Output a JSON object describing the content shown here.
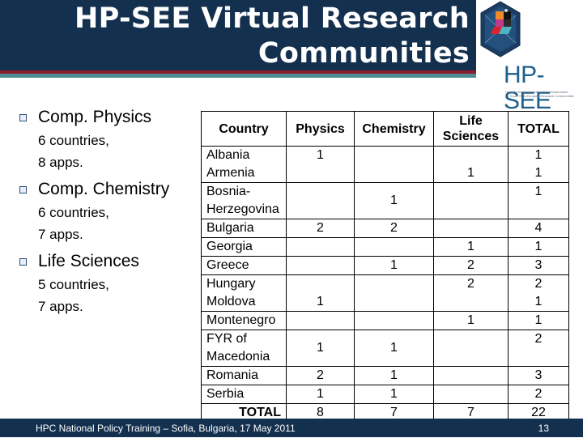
{
  "title": {
    "line1": "HP-SEE Virtual Research",
    "line2": "Communities"
  },
  "logo": {
    "name": "HP-SEE",
    "tagline_line1": "High-Performance Computing Infrastructure",
    "tagline_line2": "for South East Europe's Research Communities",
    "icon": "hp-see-hexagon-logo-icon"
  },
  "bullets": [
    {
      "heading": "Comp. Physics",
      "line1": "6 countries,",
      "line2": "8 apps.",
      "icon": "square-bullet-icon"
    },
    {
      "heading": "Comp. Chemistry",
      "line1": "6 countries,",
      "line2": "7 apps.",
      "icon": "square-bullet-icon"
    },
    {
      "heading": "Life Sciences",
      "line1": "5 countries,",
      "line2": "7 apps.",
      "icon": "square-bullet-icon"
    }
  ],
  "table": {
    "headers": {
      "country": "Country",
      "physics": "Physics",
      "chemistry": "Chemistry",
      "life_line1": "Life",
      "life_line2": "Sciences",
      "total": "TOTAL"
    },
    "rows": [
      {
        "country_lines": [
          "Albania",
          "Armenia"
        ],
        "physics": [
          "1",
          ""
        ],
        "chemistry": [
          "",
          ""
        ],
        "life": [
          "",
          "1"
        ],
        "total": [
          "1",
          "1"
        ]
      },
      {
        "country_lines": [
          "Bosnia-",
          "Herzegovina"
        ],
        "physics": "",
        "chemistry": "1",
        "life": "",
        "total": "1"
      },
      {
        "country": "Bulgaria",
        "physics": "2",
        "chemistry": "2",
        "life": "",
        "total": "4"
      },
      {
        "country": "Georgia",
        "physics": "",
        "chemistry": "",
        "life": "1",
        "total": "1"
      },
      {
        "country": "Greece",
        "physics": "",
        "chemistry": "1",
        "life": "2",
        "total": "3"
      },
      {
        "country_lines": [
          "Hungary",
          "Moldova"
        ],
        "physics": [
          "",
          "1"
        ],
        "chemistry": [
          "",
          ""
        ],
        "life": [
          "2",
          ""
        ],
        "total": [
          "2",
          "1"
        ]
      },
      {
        "country": "Montenegro",
        "physics": "",
        "chemistry": "",
        "life": "1",
        "total": "1"
      },
      {
        "country_lines": [
          "FYR of",
          "Macedonia"
        ],
        "physics": "1",
        "chemistry": "1",
        "life": "",
        "total": "2"
      },
      {
        "country": "Romania",
        "physics": "2",
        "chemistry": "1",
        "life": "",
        "total": "3"
      },
      {
        "country": "Serbia",
        "physics": "1",
        "chemistry": "1",
        "life": "",
        "total": "2"
      }
    ],
    "totals": {
      "label": "TOTAL",
      "physics": "8",
      "chemistry": "7",
      "life": "7",
      "total": "22"
    }
  },
  "footer": {
    "text": "HPC National Policy Training – Sofia, Bulgaria, 17 May 2011",
    "page_number": "13"
  },
  "colors": {
    "navy": "#14304f",
    "red_stripe": "#8c1c2a",
    "teal_stripe": "#4d8a93",
    "logo_blue": "#1f5f8b"
  }
}
